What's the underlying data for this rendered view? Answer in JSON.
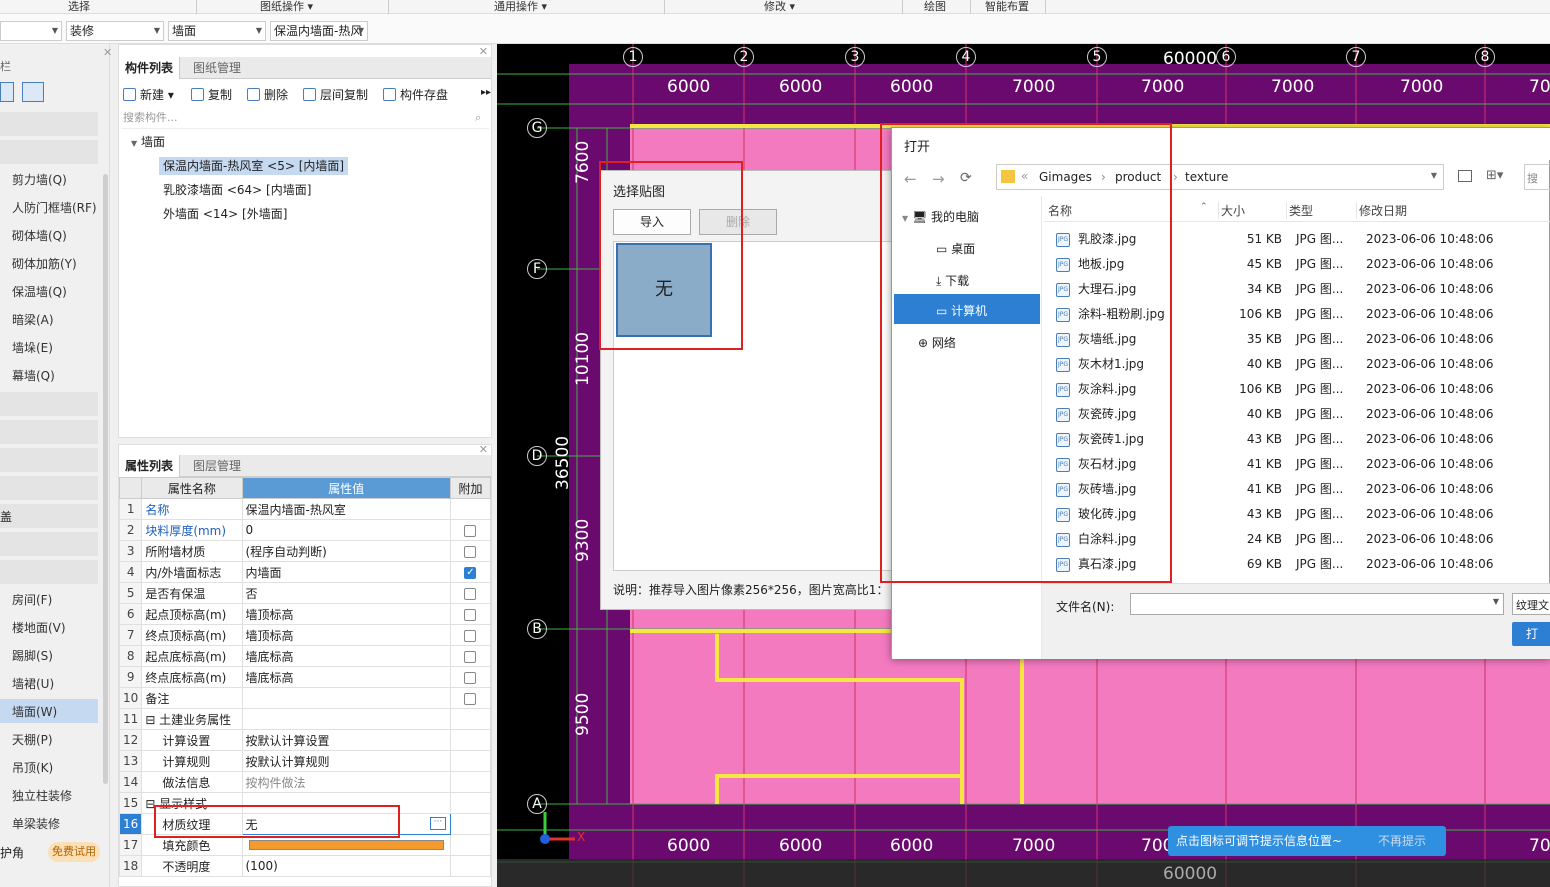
{
  "ribbon": {
    "groups": [
      "选择",
      "图纸操作 ▾",
      "通用操作 ▾",
      "修改 ▾",
      "绘图",
      "智能布置"
    ]
  },
  "selbar": {
    "sel1": "",
    "sel2": "装修",
    "sel3": "墙面",
    "sel4": "保温内墙面-热风"
  },
  "leftnav": {
    "items": [
      "剪力墙(Q)",
      "人防门框墙(RF)",
      "砌体墙(Q)",
      "砌体加筋(Y)",
      "保温墙(Q)",
      "暗梁(A)",
      "墙垛(E)",
      "幕墙(Q)"
    ],
    "group_label": "盖",
    "items2": [
      "房间(F)",
      "楼地面(V)",
      "踢脚(S)",
      "墙裙(U)",
      "墙面(W)",
      "天棚(P)",
      "吊顶(K)",
      "独立柱装修",
      "单梁装修"
    ],
    "bottom_left": "护角",
    "free_trial": "免费试用"
  },
  "comp": {
    "tab1": "构件列表",
    "tab2": "图纸管理",
    "new": "新建 ▾",
    "copy": "复制",
    "delete": "删除",
    "floor_copy": "层间复制",
    "save": "构件存盘",
    "search_placeholder": "搜索构件...",
    "root": "墙面",
    "items": [
      "保温内墙面-热风室 <5> [内墙面]",
      "乳胶漆墙面 <64> [内墙面]",
      "外墙面 <14> [外墙面]"
    ]
  },
  "props": {
    "tab1": "属性列表",
    "tab2": "图层管理",
    "h_name": "属性名称",
    "h_value": "属性值",
    "h_extra": "附加",
    "rows": [
      {
        "n": "1",
        "name": "名称",
        "value": "保温内墙面-热风室",
        "chk": ""
      },
      {
        "n": "2",
        "name": "块料厚度(mm)",
        "value": "0",
        "chk": "off"
      },
      {
        "n": "3",
        "name": "所附墙材质",
        "value": "(程序自动判断)",
        "chk": "off"
      },
      {
        "n": "4",
        "name": "内/外墙面标志",
        "value": "内墙面",
        "chk": "on"
      },
      {
        "n": "5",
        "name": "是否有保温",
        "value": "否",
        "chk": "off"
      },
      {
        "n": "6",
        "name": "起点顶标高(m)",
        "value": "墙顶标高",
        "chk": "off"
      },
      {
        "n": "7",
        "name": "终点顶标高(m)",
        "value": "墙顶标高",
        "chk": "off"
      },
      {
        "n": "8",
        "name": "起点底标高(m)",
        "value": "墙底标高",
        "chk": "off"
      },
      {
        "n": "9",
        "name": "终点底标高(m)",
        "value": "墙底标高",
        "chk": "off"
      },
      {
        "n": "10",
        "name": "备注",
        "value": "",
        "chk": "off"
      },
      {
        "n": "11",
        "name": "⊟ 土建业务属性",
        "value": "",
        "chk": ""
      },
      {
        "n": "12",
        "name": "计算设置",
        "value": "按默认计算设置",
        "chk": ""
      },
      {
        "n": "13",
        "name": "计算规则",
        "value": "按默认计算规则",
        "chk": ""
      },
      {
        "n": "14",
        "name": "做法信息",
        "value": "按构件做法",
        "chk": ""
      },
      {
        "n": "15",
        "name": "⊟ 显示样式",
        "value": "",
        "chk": ""
      },
      {
        "n": "16",
        "name": "材质纹理",
        "value": "无",
        "chk": ""
      },
      {
        "n": "17",
        "name": "填充颜色",
        "value": "",
        "chk": ""
      },
      {
        "n": "18",
        "name": "不透明度",
        "value": "(100)",
        "chk": ""
      }
    ]
  },
  "cad": {
    "top_axes": [
      "1",
      "2",
      "3",
      "4",
      "5",
      "6",
      "7",
      "8"
    ],
    "top_dims": [
      "6000",
      "6000",
      "6000",
      "7000",
      "7000",
      "7000",
      "7000",
      "70"
    ],
    "total_top": "60000",
    "left_axes": [
      "G",
      "F",
      "D",
      "B",
      "A"
    ],
    "left_dims": [
      "7600",
      "10100",
      "9300",
      "9500"
    ],
    "total_left": "36500",
    "bottom_dims": [
      "6000",
      "6000",
      "6000",
      "7000",
      "700",
      "70"
    ],
    "bottom_total": "60000",
    "x_label": "X"
  },
  "texdlg": {
    "title": "选择贴图",
    "import": "导入",
    "delete": "删除",
    "none": "无",
    "note": "说明：推荐导入图片像素256*256，图片宽高比1："
  },
  "opendlg": {
    "title": "打开",
    "path": [
      "Gimages",
      "product",
      "texture"
    ],
    "search": "搜索",
    "nav": [
      "我的电脑",
      "桌面",
      "下载",
      "计算机",
      "网络"
    ],
    "cols": [
      "名称",
      "大小",
      "类型",
      "修改日期"
    ],
    "files": [
      {
        "name": "乳胶漆.jpg",
        "size": "51 KB",
        "type": "JPG 图...",
        "date": "2023-06-06 10:48:06"
      },
      {
        "name": "地板.jpg",
        "size": "45 KB",
        "type": "JPG 图...",
        "date": "2023-06-06 10:48:06"
      },
      {
        "name": "大理石.jpg",
        "size": "34 KB",
        "type": "JPG 图...",
        "date": "2023-06-06 10:48:06"
      },
      {
        "name": "涂料-粗粉刷.jpg",
        "size": "106 KB",
        "type": "JPG 图...",
        "date": "2023-06-06 10:48:06"
      },
      {
        "name": "灰墙纸.jpg",
        "size": "35 KB",
        "type": "JPG 图...",
        "date": "2023-06-06 10:48:06"
      },
      {
        "name": "灰木材1.jpg",
        "size": "40 KB",
        "type": "JPG 图...",
        "date": "2023-06-06 10:48:06"
      },
      {
        "name": "灰涂料.jpg",
        "size": "106 KB",
        "type": "JPG 图...",
        "date": "2023-06-06 10:48:06"
      },
      {
        "name": "灰瓷砖.jpg",
        "size": "40 KB",
        "type": "JPG 图...",
        "date": "2023-06-06 10:48:06"
      },
      {
        "name": "灰瓷砖1.jpg",
        "size": "43 KB",
        "type": "JPG 图...",
        "date": "2023-06-06 10:48:06"
      },
      {
        "name": "灰石材.jpg",
        "size": "41 KB",
        "type": "JPG 图...",
        "date": "2023-06-06 10:48:06"
      },
      {
        "name": "灰砖墙.jpg",
        "size": "41 KB",
        "type": "JPG 图...",
        "date": "2023-06-06 10:48:06"
      },
      {
        "name": "玻化砖.jpg",
        "size": "43 KB",
        "type": "JPG 图...",
        "date": "2023-06-06 10:48:06"
      },
      {
        "name": "白涂料.jpg",
        "size": "24 KB",
        "type": "JPG 图...",
        "date": "2023-06-06 10:48:06"
      },
      {
        "name": "真石漆.jpg",
        "size": "69 KB",
        "type": "JPG 图...",
        "date": "2023-06-06 10:48:06"
      }
    ],
    "filename_label": "文件名(N):",
    "filter": "纹理文",
    "open": "打"
  },
  "tip": {
    "text": "点击图标可调节提示信息位置~",
    "dismiss": "不再提示"
  },
  "colors": {
    "purple": "#6b0a6e",
    "pink": "#f47ac0",
    "yellow": "#f5e642",
    "accent": "#2d7fd4",
    "fill_orange": "#f59a2c"
  }
}
